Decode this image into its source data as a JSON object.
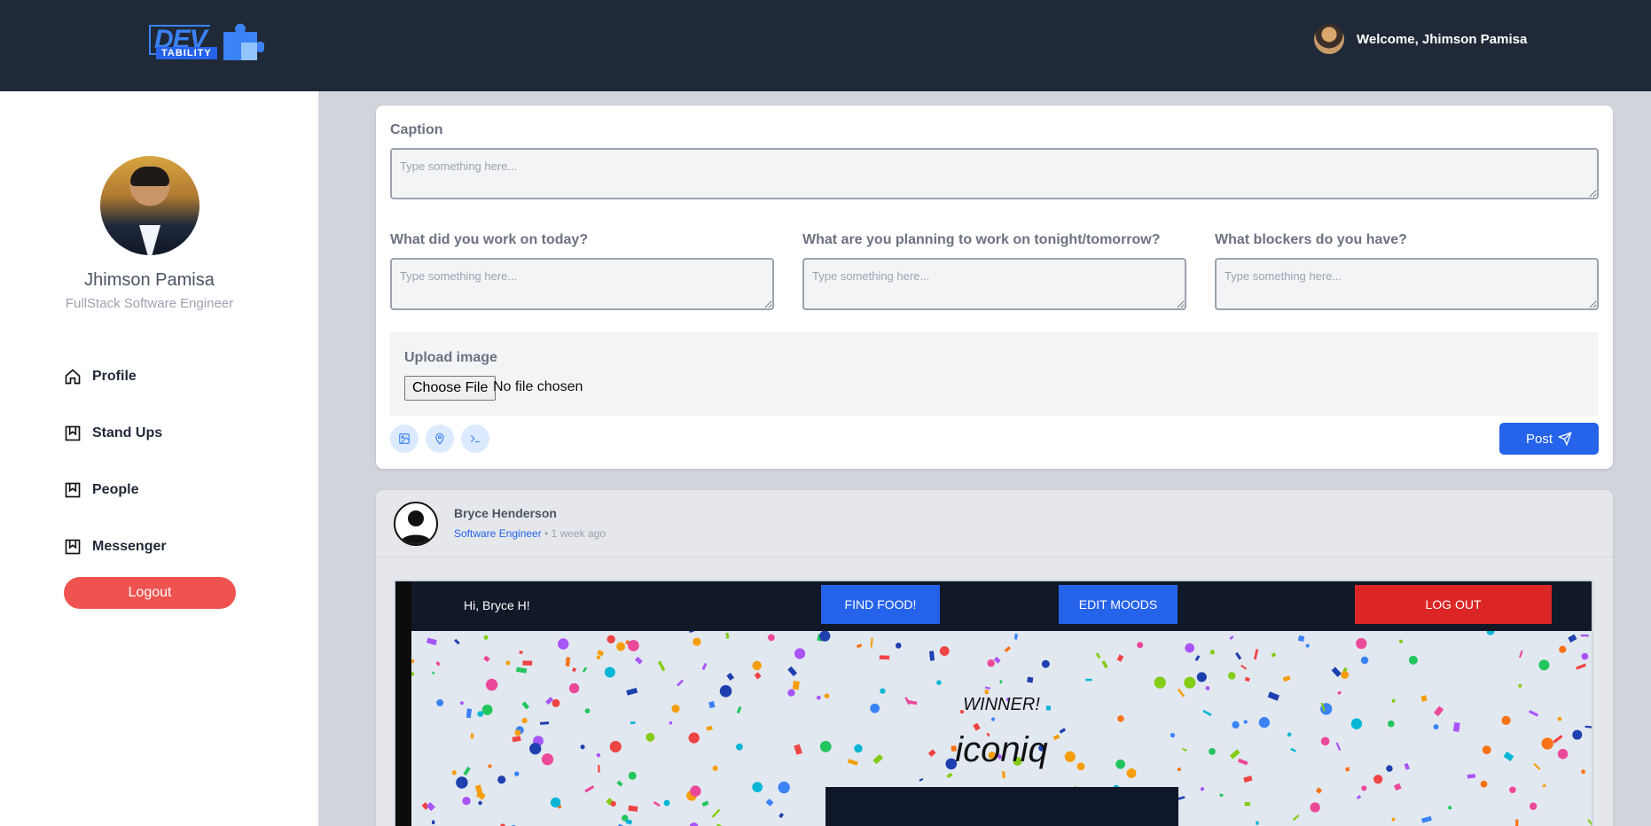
{
  "header": {
    "logo_main": "DEV",
    "logo_sub": "TABILITY",
    "welcome": "Welcome, Jhimson Pamisa"
  },
  "sidebar": {
    "name": "Jhimson Pamisa",
    "role": "FullStack Software Engineer",
    "items": [
      {
        "label": "Profile",
        "icon": "home-icon"
      },
      {
        "label": "Stand Ups",
        "icon": "bookmark-icon"
      },
      {
        "label": "People",
        "icon": "bookmark-icon"
      },
      {
        "label": "Messenger",
        "icon": "bookmark-icon"
      }
    ],
    "logout": "Logout"
  },
  "form": {
    "caption_label": "Caption",
    "caption_placeholder": "Type something here...",
    "q1_label": "What did you work on today?",
    "q2_label": "What are you planning to work on tonight/tomorrow?",
    "q3_label": "What blockers do you have?",
    "placeholder": "Type something here...",
    "upload_label": "Upload image",
    "choose_file": "Choose File",
    "no_file": "No file chosen",
    "tools": [
      "image-icon",
      "location-pin-icon",
      "terminal-icon"
    ],
    "post": "Post"
  },
  "feed": {
    "author": "Bryce Henderson",
    "role": "Software Engineer",
    "time": "• 1 week ago",
    "shot": {
      "greeting": "Hi, Bryce H!",
      "find_food": "FIND FOOD!",
      "edit_moods": "EDIT MOODS",
      "log_out": "LOG OUT",
      "winner": "WINNER!",
      "brand": "iconiq"
    }
  },
  "colors": {
    "header_bg": "#1f2937",
    "primary": "#2563eb",
    "logout": "#ef5350",
    "danger": "#dc2626"
  }
}
